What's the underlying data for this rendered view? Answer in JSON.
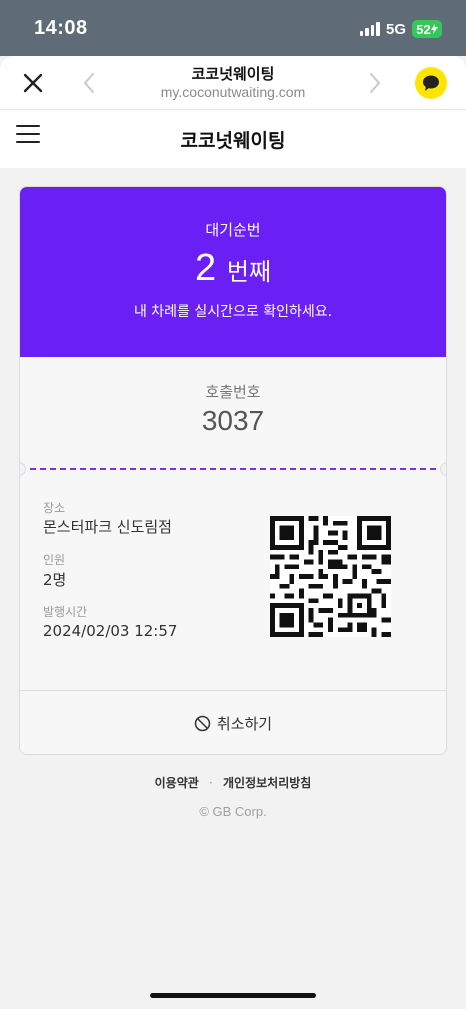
{
  "status_bar": {
    "time": "14:08",
    "network": "5G",
    "battery": "52"
  },
  "browser": {
    "title": "코코넛웨이팅",
    "url": "my.coconutwaiting.com",
    "close_icon": "close-icon",
    "back_icon": "chevron-left-icon",
    "forward_icon": "chevron-right-icon",
    "kakao_icon": "kakao-chat-icon"
  },
  "app_header": {
    "title": "코코넛웨이팅",
    "menu_icon": "hamburger-menu-icon"
  },
  "ticket": {
    "accent_color": "#6a1ff5",
    "wait_label": "대기순번",
    "wait_number": "2",
    "wait_unit": "번째",
    "wait_desc": "내 차례를 실시간으로 확인하세요.",
    "call_label": "호출번호",
    "call_number": "3037",
    "info": [
      {
        "label": "장소",
        "value": "몬스터파크 신도림점"
      },
      {
        "label": "인원",
        "value": "2명"
      },
      {
        "label": "발행시간",
        "value": "2024/02/03 12:57"
      }
    ],
    "cancel_label": "취소하기",
    "cancel_icon": "prohibited-circle-icon",
    "qr_icon": "qr-code"
  },
  "footer": {
    "terms": "이용약관",
    "separator": "·",
    "privacy": "개인정보처리방침",
    "copyright": "© GB Corp."
  }
}
